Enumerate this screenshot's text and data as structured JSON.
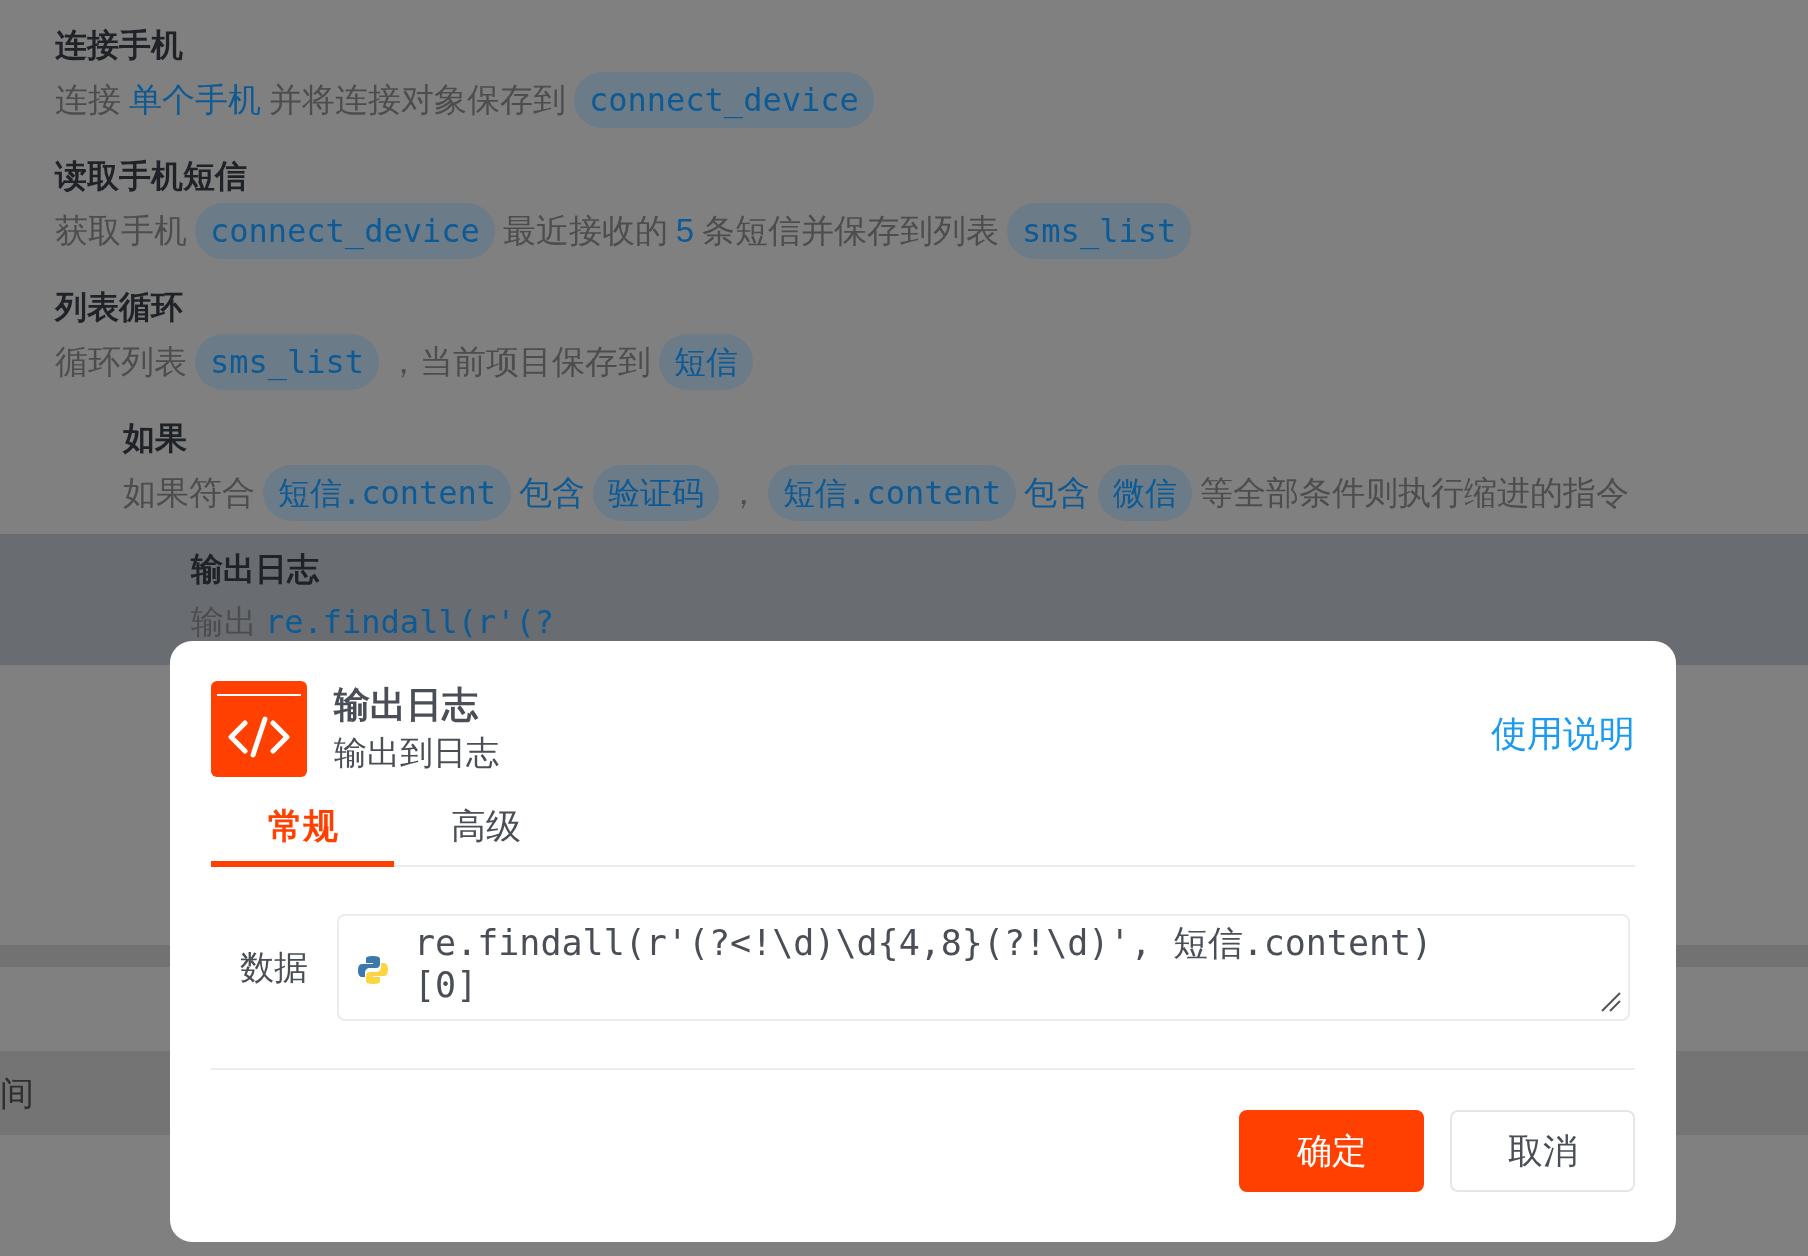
{
  "steps": [
    {
      "title": "连接手机",
      "selected": false,
      "description": [
        {
          "kind": "text",
          "text": "连接"
        },
        {
          "kind": "value",
          "text": "单个手机"
        },
        {
          "kind": "text",
          "text": "并将连接对象保存到"
        },
        {
          "kind": "tag",
          "text": "connect_device"
        }
      ]
    },
    {
      "title": "读取手机短信",
      "selected": false,
      "description": [
        {
          "kind": "text",
          "text": "获取手机"
        },
        {
          "kind": "tag",
          "text": "connect_device"
        },
        {
          "kind": "text",
          "text": "最近接收的"
        },
        {
          "kind": "value",
          "text": "5"
        },
        {
          "kind": "text",
          "text": "条短信并保存到列表"
        },
        {
          "kind": "tag",
          "text": "sms_list"
        }
      ]
    },
    {
      "title": "列表循环",
      "selected": false,
      "description": [
        {
          "kind": "text",
          "text": "循环列表"
        },
        {
          "kind": "tag",
          "text": "sms_list"
        },
        {
          "kind": "text",
          "text": "，当前项目保存到"
        },
        {
          "kind": "tag",
          "text": "短信"
        }
      ],
      "children": [
        {
          "title": "如果",
          "selected": false,
          "description": [
            {
              "kind": "text",
              "text": "如果符合"
            },
            {
              "kind": "tag",
              "text": "短信.content"
            },
            {
              "kind": "value",
              "text": "包含"
            },
            {
              "kind": "tag",
              "text": "验证码"
            },
            {
              "kind": "text",
              "text": "，"
            },
            {
              "kind": "tag",
              "text": "短信.content"
            },
            {
              "kind": "value",
              "text": "包含"
            },
            {
              "kind": "tag",
              "text": "微信"
            },
            {
              "kind": "text",
              "text": "等全部条件则执行缩进的指令"
            }
          ],
          "children": [
            {
              "title": "输出日志",
              "selected": true,
              "description": [
                {
                  "kind": "text",
                  "text": "输出"
                },
                {
                  "kind": "code",
                  "text": "re.findall(r'(?"
                }
              ]
            }
          ]
        }
      ]
    }
  ],
  "bottom_row": {
    "label": "间"
  },
  "dialog": {
    "title": "输出日志",
    "subtitle": "输出到日志",
    "help_link": "使用说明",
    "tabs": [
      {
        "label": "常规",
        "selected": true
      },
      {
        "label": "高级",
        "selected": false
      }
    ],
    "field": {
      "label": "数据",
      "value": "re.findall(r'(?<!\\d)\\d{4,8}(?!\\d)', 短信.content)[0]"
    },
    "buttons": [
      {
        "label": "确定",
        "kind": "primary"
      },
      {
        "label": "取消",
        "kind": "secondary"
      }
    ]
  }
}
